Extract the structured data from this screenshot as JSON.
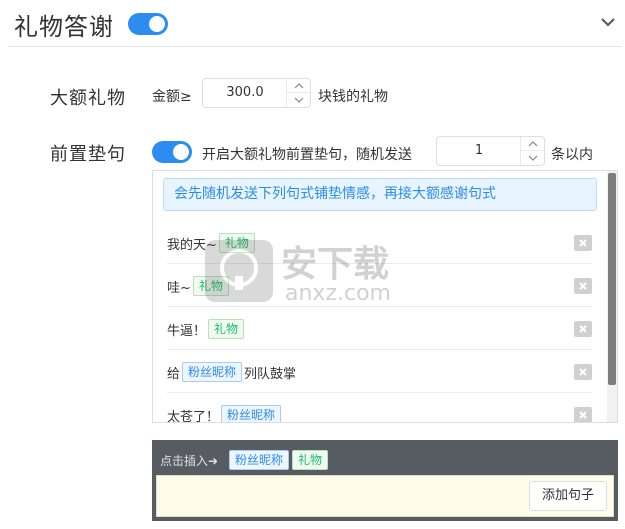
{
  "header": {
    "title": "礼物答谢",
    "toggle_on": true
  },
  "big_gift": {
    "label": "大额礼物",
    "amount_label": "金额≥",
    "amount_value": "300.0",
    "suffix": "块钱的礼物"
  },
  "prefix_sentence": {
    "label": "前置垫句",
    "toggle_on": true,
    "toggle_label": "开启大额礼物前置垫句，随机发送",
    "count_value": "1",
    "count_suffix": "条以内"
  },
  "notice": "会先随机发送下列句式铺垫情感，再接大额感谢句式",
  "phrases": [
    {
      "before": "我的天~",
      "tag": "礼物",
      "tag_type": "gift",
      "after": ""
    },
    {
      "before": "哇~",
      "tag": "礼物",
      "tag_type": "gift",
      "after": ""
    },
    {
      "before": "牛逼！",
      "tag": "礼物",
      "tag_type": "gift",
      "after": ""
    },
    {
      "before": "给",
      "tag": "粉丝昵称",
      "tag_type": "nick",
      "after": "列队鼓掌"
    },
    {
      "before": "太苍了！",
      "tag": "粉丝昵称",
      "tag_type": "nick",
      "after": ""
    }
  ],
  "insert_bar": {
    "label": "点击插入➜",
    "tags": [
      {
        "text": "粉丝昵称",
        "type": "nick"
      },
      {
        "text": "礼物",
        "type": "gift"
      }
    ],
    "add_button": "添加句子"
  },
  "colors": {
    "accent": "#2d8cf0",
    "gift_tag": "#19be6b",
    "bar_bg": "#575c63",
    "input_bg": "#fffde8"
  },
  "watermark": {
    "cn": "安下载",
    "en": "anxz.com"
  }
}
